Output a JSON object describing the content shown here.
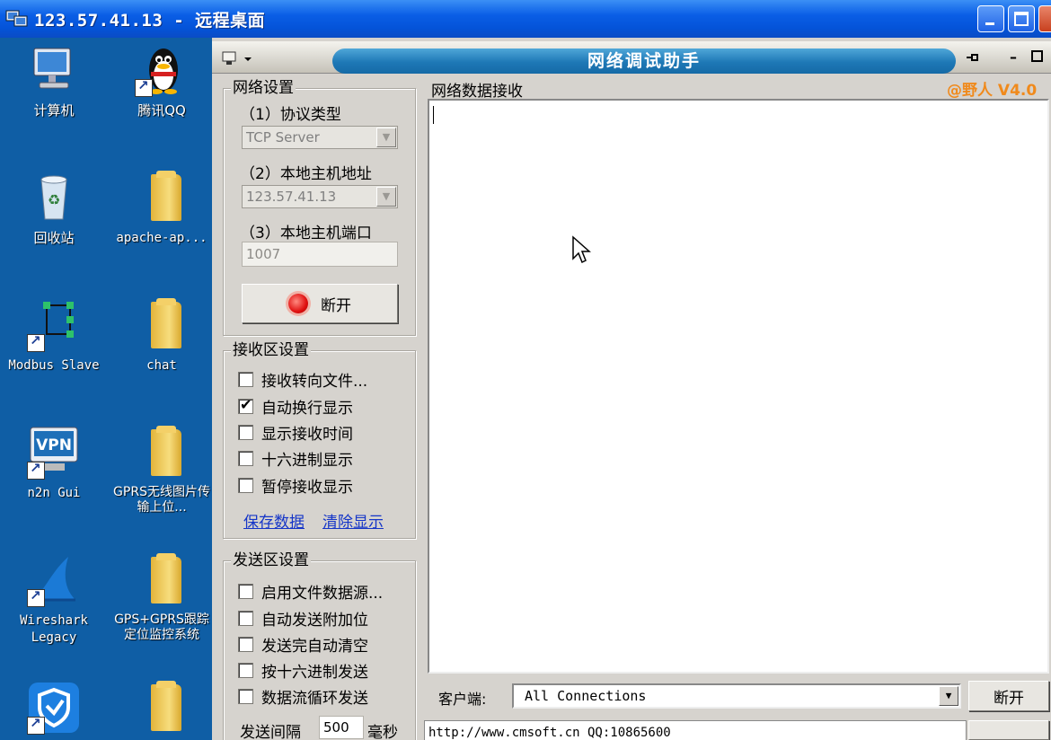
{
  "rdp": {
    "title": "123.57.41.13 - 远程桌面"
  },
  "desktop": {
    "icons": [
      {
        "label": "计算机"
      },
      {
        "label": "腾讯QQ"
      },
      {
        "label": "回收站"
      },
      {
        "label": "apache-ap..."
      },
      {
        "label": "Modbus Slave"
      },
      {
        "label": "chat"
      },
      {
        "label": "n2n Gui"
      },
      {
        "label": "GPRS无线图片传输上位..."
      },
      {
        "label": "Wireshark Legacy"
      },
      {
        "label": "GPS+GPRS跟踪定位监控系统"
      },
      {
        "label": ""
      },
      {
        "label": ""
      }
    ]
  },
  "app": {
    "title": "网络调试助手",
    "brand": "@野人 V4.0",
    "net": {
      "group_title": "网络设置",
      "protocol_label": "（1）协议类型",
      "protocol_value": "TCP Server",
      "host_label": "（2）本地主机地址",
      "host_value": "123.57.41.13",
      "port_label": "（3）本地主机端口",
      "port_value": "1007",
      "disconnect_label": "断开"
    },
    "recv": {
      "group_title": "接收区设置",
      "options": [
        {
          "label": "接收转向文件...",
          "checked": false
        },
        {
          "label": "自动换行显示",
          "checked": true
        },
        {
          "label": "显示接收时间",
          "checked": false
        },
        {
          "label": "十六进制显示",
          "checked": false
        },
        {
          "label": "暂停接收显示",
          "checked": false
        }
      ],
      "save_link": "保存数据",
      "clear_link": "清除显示"
    },
    "send": {
      "group_title": "发送区设置",
      "options": [
        {
          "label": "启用文件数据源...",
          "checked": false
        },
        {
          "label": "自动发送附加位",
          "checked": false
        },
        {
          "label": "发送完自动清空",
          "checked": false
        },
        {
          "label": "按十六进制发送",
          "checked": false
        },
        {
          "label": "数据流循环发送",
          "checked": false
        }
      ],
      "interval_label": "发送间隔",
      "interval_value": "500",
      "interval_unit": "毫秒"
    },
    "data_recv": {
      "group_title": "网络数据接收"
    },
    "client": {
      "label": "客户端:",
      "selected": "All Connections",
      "disconnect_label": "断开"
    },
    "url": "http://www.cmsoft.cn QQ:10865600"
  }
}
